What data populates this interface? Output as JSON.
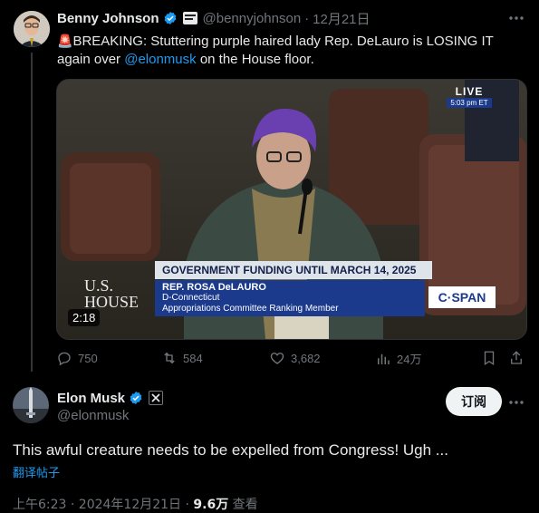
{
  "original_tweet": {
    "author_name": "Benny Johnson",
    "handle": "@bennyjohnson",
    "separator": "·",
    "date": "12月21日",
    "alarm_emoji": "🚨",
    "text_before_link": "BREAKING: Stuttering purple haired lady Rep. DeLauro is LOSING IT again over ",
    "link_text": "@elonmusk",
    "text_after_link": " on the House floor.",
    "video": {
      "live_label": "LIVE",
      "live_time": "5:03 pm ET",
      "network_left_line1": "U.S.",
      "network_left_line2": "HOUSE",
      "banner_headline": "GOVERNMENT FUNDING UNTIL MARCH 14, 2025",
      "banner_name": "REP. ROSA DeLAURO",
      "banner_party": "D-Connecticut",
      "banner_role": "Appropriations Committee Ranking Member",
      "cspan_logo": "C·SPAN",
      "duration": "2:18"
    },
    "stats": {
      "replies": "750",
      "reposts": "584",
      "likes": "3,682",
      "views": "24万"
    }
  },
  "reply_tweet": {
    "author_name": "Elon Musk",
    "handle": "@elonmusk",
    "follow_label": "订阅",
    "text": "This awful creature needs to be expelled from Congress! Ugh ...",
    "translate_label": "翻译帖子",
    "timestamp": "上午6:23 · 2024年12月21日 · ",
    "views_count": "9.6万",
    "views_label": " 查看"
  },
  "colors": {
    "background": "#000000",
    "text_primary": "#e7e9ea",
    "text_muted": "#71767b",
    "link": "#1d9bf0",
    "verified": "#1d9bf0",
    "banner_blue": "#1b3a8c",
    "alarm_red": "#e0245e"
  },
  "icons": [
    "verified-badge-icon",
    "affiliate-badge-icon",
    "more-icon",
    "reply-icon",
    "repost-icon",
    "like-icon",
    "views-icon",
    "bookmark-icon",
    "share-icon",
    "x-logo-icon"
  ]
}
